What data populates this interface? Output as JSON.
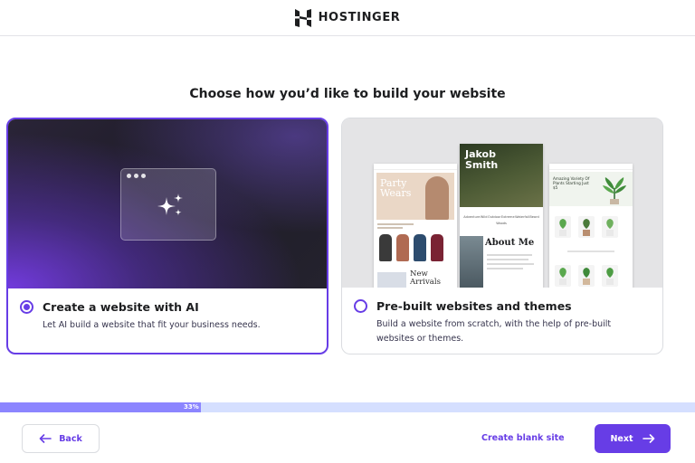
{
  "header": {
    "brand": "HOSTINGER",
    "logo_icon": "hostinger-logo-icon"
  },
  "heading": "Choose how you’d like to build your website",
  "options": [
    {
      "title": "Create a website with AI",
      "description": "Let AI build a website that fit your business needs.",
      "selected": true,
      "icon": "sparkles-icon"
    },
    {
      "title": "Pre-built websites and themes",
      "description": "Build a website from scratch, with the help of pre-built websites or themes.",
      "selected": false
    }
  ],
  "theme_previews": {
    "fashion": {
      "hero_title": "Party\nWears",
      "section_title": "New\nArrivals"
    },
    "portfolio": {
      "hero_title": "Jakob\nSmith",
      "nav": [
        "Adventure",
        "Wild",
        "Outdoor",
        "Extreme",
        "Waterfall",
        "Beard",
        "Woods"
      ],
      "section_title": "About Me"
    },
    "plants": {
      "hero_text": "Amazing Variety Of Plants Starting Just $5"
    }
  },
  "progress": {
    "percent": 33,
    "label": "33%"
  },
  "footer": {
    "back_label": "Back",
    "blank_site_label": "Create blank site",
    "next_label": "Next"
  },
  "colors": {
    "accent": "#673de6",
    "progress_fill": "#8c85ff",
    "progress_track": "#d5dfff"
  }
}
